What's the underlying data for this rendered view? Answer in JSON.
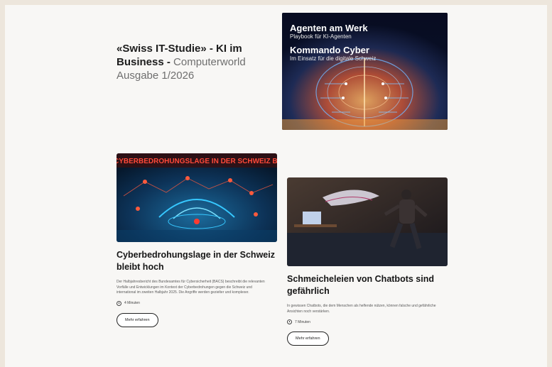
{
  "hero": {
    "title_bold": "«Swiss IT-Studie» - KI im Business -",
    "title_light": " Computerworld Ausgabe 1/2026",
    "image": {
      "heading1": "Agenten am Werk",
      "sub1": "Playbook für KI-Agenten",
      "heading2": "Kommando Cyber",
      "sub2": "Im Einsatz für die digitale Schweiz"
    }
  },
  "articles": [
    {
      "image_banner": "CYBERBEDROHUNGSLAGE IN DER SCHWEIZ BLEIBT HOCH",
      "title": "Cyberbedrohungslage in der Schweiz bleibt hoch",
      "teaser": "Der Halbjahresbericht des Bundesamtes für Cybersicherheit (BACS) beschreibt die relevanten Vorfälle und Entwicklungen im Kontext der Cyberbedrohungen gegen die Schweiz und international im zweiten Halbjahr 2025. Die Angriffe werden gezielter und komplexer.",
      "read_time": "4 Minuten",
      "button": "Mehr erfahren"
    },
    {
      "title": "Schmeicheleien von Chatbots sind gefährlich",
      "teaser": "In gewissen Chatbots, die dem Menschen als helfende nützen, können falsche und gefährliche Ansichten noch verstärken.",
      "read_time": "7 Minuten",
      "button": "Mehr erfahren"
    }
  ],
  "colors": {
    "page_bg": "#f8f7f5",
    "outer_bg": "#ede6dc",
    "hero_accent": "#f0a040",
    "map_glow": "#36c8ff"
  }
}
